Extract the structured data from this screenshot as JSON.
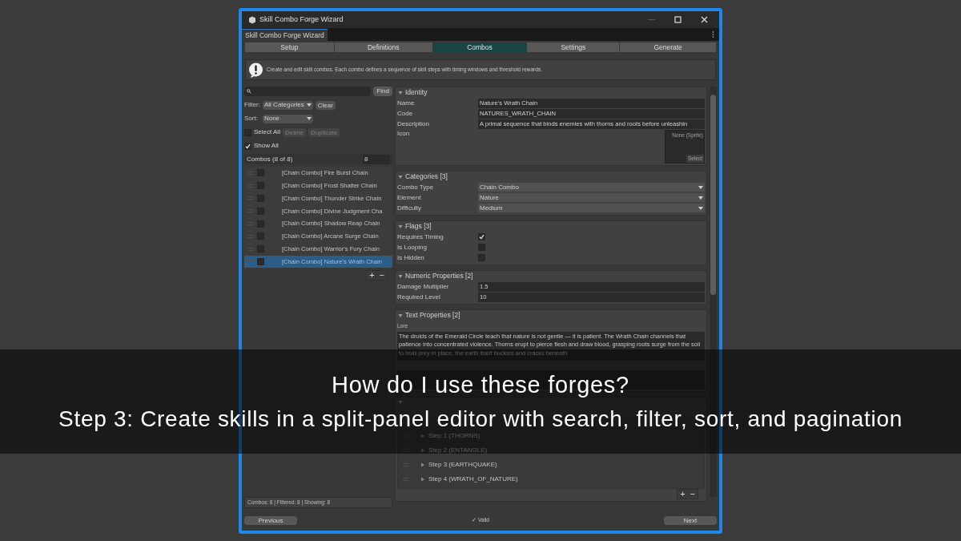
{
  "window": {
    "title": "Skill Combo Forge Wizard"
  },
  "doc_tab": {
    "label": "Skill Combo Forge Wizard"
  },
  "tabs": [
    {
      "label": "Setup",
      "selected": false
    },
    {
      "label": "Definitions",
      "selected": false
    },
    {
      "label": "Combos",
      "selected": true
    },
    {
      "label": "Settings",
      "selected": false
    },
    {
      "label": "Generate",
      "selected": false
    }
  ],
  "info": "Create and edit skill combos. Each combo defines a sequence of skill steps with timing windows and threshold rewards.",
  "left": {
    "find_button": "Find",
    "filter_label": "Filter:",
    "filter_value": "All Categories",
    "clear_button": "Clear",
    "sort_label": "Sort:",
    "sort_value": "None",
    "select_all": {
      "label": "Select All",
      "checked": false
    },
    "actions": [
      {
        "label": "Delete",
        "disabled": true
      },
      {
        "label": "Duplicate",
        "disabled": true
      }
    ],
    "show_all": {
      "label": "Show All",
      "checked": true
    },
    "list_header": "Combos (8 of 8)",
    "page_size": "8",
    "items": [
      {
        "label": "[Chain Combo] Fire Burst Chain",
        "checked": false,
        "selected": false
      },
      {
        "label": "[Chain Combo] Frost Shatter Chain",
        "checked": false,
        "selected": false
      },
      {
        "label": "[Chain Combo] Thunder Strike Chain",
        "checked": false,
        "selected": false
      },
      {
        "label": "[Chain Combo] Divine Judgment Cha",
        "checked": false,
        "selected": false
      },
      {
        "label": "[Chain Combo] Shadow Reap Chain",
        "checked": false,
        "selected": false
      },
      {
        "label": "[Chain Combo] Arcane Surge Chain",
        "checked": false,
        "selected": false
      },
      {
        "label": "[Chain Combo] Warrior's Fury Chain",
        "checked": false,
        "selected": false
      },
      {
        "label": "[Chain Combo] Nature's Wrath Chain",
        "checked": false,
        "selected": true
      }
    ],
    "add": "+",
    "remove": "−",
    "status": "Combos: 8 | Filtered: 8 | Showing: 8"
  },
  "sections": [
    {
      "title": "Identity",
      "expanded": true,
      "fields": [
        {
          "kind": "text",
          "label": "Name",
          "value": "Nature's Wrath Chain"
        },
        {
          "kind": "text",
          "label": "Code",
          "value": "NATURES_WRATH_CHAIN"
        },
        {
          "kind": "text",
          "label": "Description",
          "value": "A primal sequence that binds enemies with thorns and roots before unleashin"
        },
        {
          "kind": "sprite",
          "label": "Icon",
          "placeholder": "None (Sprite)",
          "button": "Select"
        }
      ]
    },
    {
      "title": "Categories [3]",
      "expanded": true,
      "fields": [
        {
          "kind": "dropdown",
          "label": "Combo Type",
          "value": "Chain Combo"
        },
        {
          "kind": "dropdown",
          "label": "Element",
          "value": "Nature"
        },
        {
          "kind": "dropdown",
          "label": "Difficulty",
          "value": "Medium"
        }
      ]
    },
    {
      "title": "Flags [3]",
      "expanded": true,
      "fields": [
        {
          "kind": "checkbox",
          "label": "Requires Timing",
          "checked": true
        },
        {
          "kind": "checkbox",
          "label": "Is Looping",
          "checked": false
        },
        {
          "kind": "checkbox",
          "label": "Is Hidden",
          "checked": false
        }
      ]
    },
    {
      "title": "Numeric Properties [2]",
      "expanded": true,
      "fields": [
        {
          "kind": "text",
          "label": "Damage Multiplier",
          "value": "1.5"
        },
        {
          "kind": "text",
          "label": "Required Level",
          "value": "10"
        }
      ]
    },
    {
      "title": "Text Properties [2]",
      "expanded": true,
      "fields": [
        {
          "kind": "textarea",
          "label": "Lore",
          "value": "The druids of the Emerald Circle teach that nature is not gentle — it is patient. The Wrath Chain channels that patience into concentrated violence. Thorns erupt to pierce flesh and draw blood, grasping roots surge from the soil to hold prey in place, the earth itself buckles and cracks beneath"
        },
        {
          "kind": "notation"
        }
      ]
    },
    {
      "expanded": true,
      "fields": [
        {
          "kind": "count"
        },
        {
          "kind": "steps",
          "items": [
            {
              "label": "Step 1 (THORNS)",
              "expanded": false
            },
            {
              "label": "Step 2 (ENTANGLE)",
              "expanded": false
            },
            {
              "label": "Step 3 (EARTHQUAKE)",
              "expanded": false
            },
            {
              "label": "Step 4 (WRATH_OF_NATURE)",
              "expanded": false
            }
          ],
          "add": "+",
          "remove": "−"
        }
      ]
    }
  ],
  "footer": {
    "previous": "Previous",
    "status": "✓ Valid",
    "next": "Next"
  },
  "caption": {
    "title": "How do I use these forges?",
    "subtitle": "Step 3: Create skills in a split-panel editor with search, filter, sort, and pagination"
  }
}
